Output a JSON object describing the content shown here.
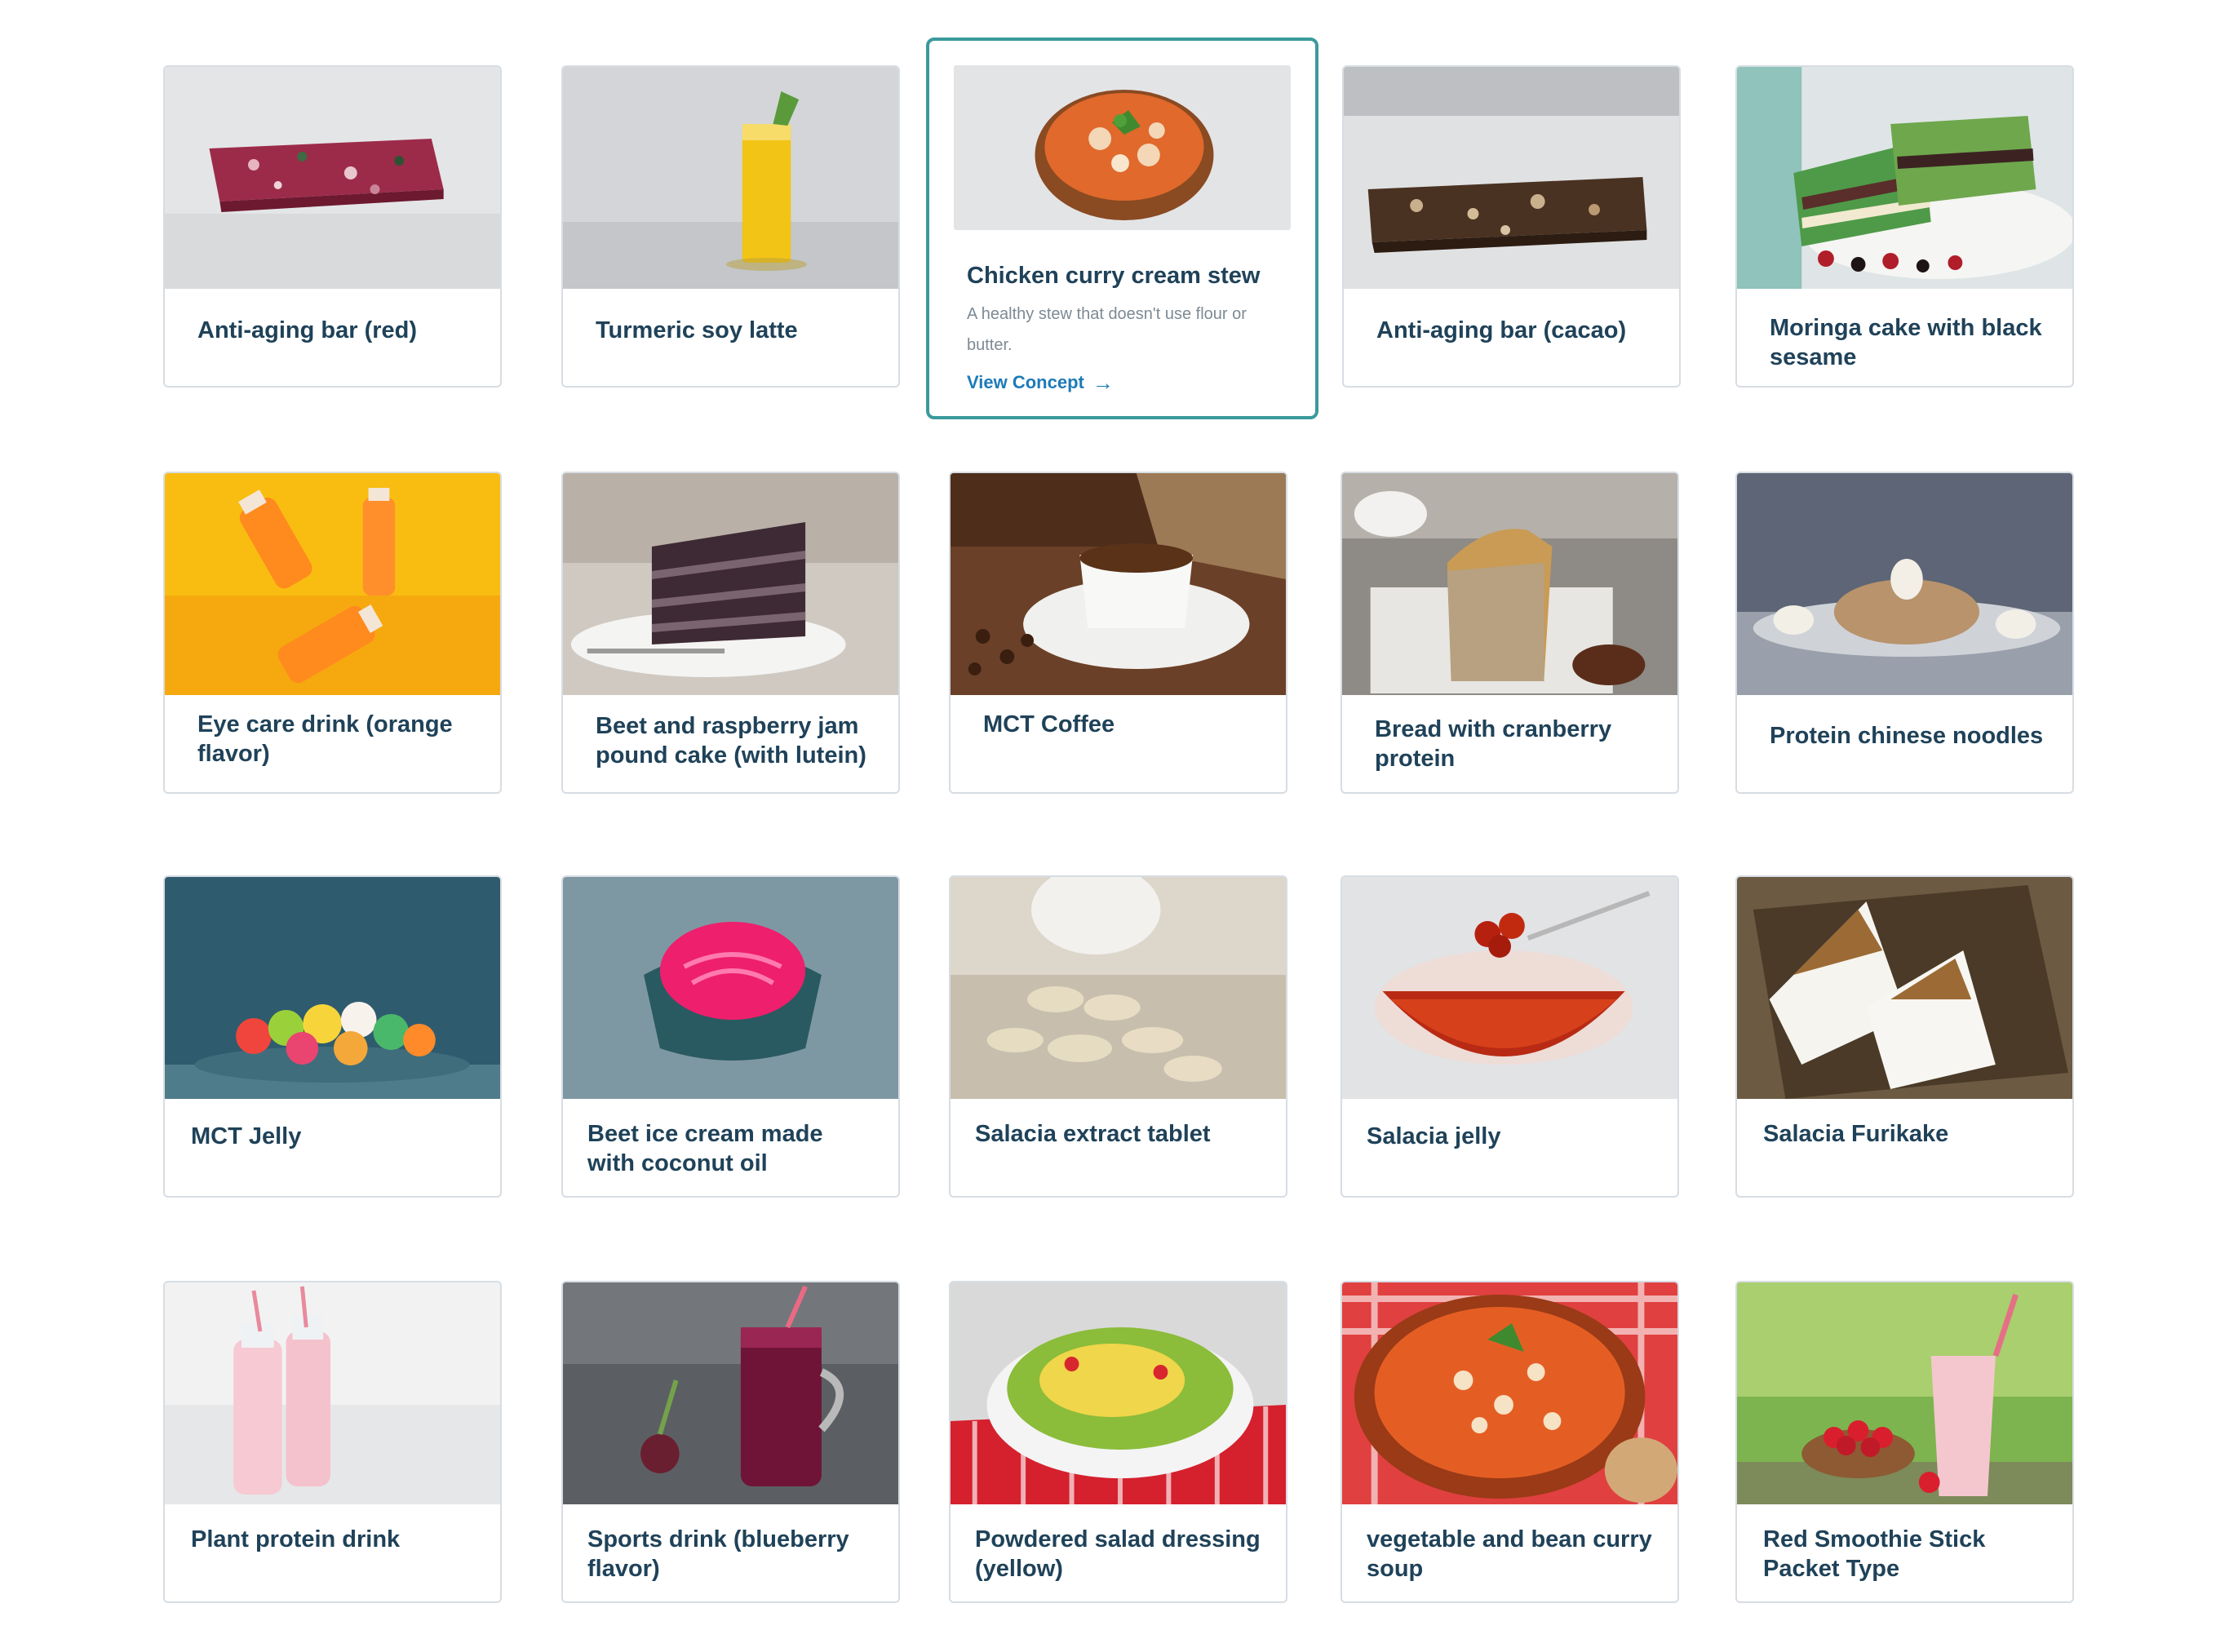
{
  "products": [
    {
      "id": "anti-aging-bar-red",
      "title": "Anti-aging bar (red)",
      "icon": "red-bar-image"
    },
    {
      "id": "turmeric-soy-latte",
      "title": "Turmeric soy latte",
      "icon": "yellow-latte-glass-image"
    },
    {
      "id": "chicken-curry-cream-stew",
      "title": "Chicken curry cream stew",
      "icon": "stew-bowl-image",
      "description": "A healthy stew that doesn't use flour or butter.",
      "link_label": "View Concept"
    },
    {
      "id": "anti-aging-bar-cacao",
      "title": "Anti-aging bar (cacao)",
      "icon": "cacao-bar-image"
    },
    {
      "id": "moringa-cake",
      "title": "Moringa cake with black sesame",
      "icon": "green-layer-cake-image"
    },
    {
      "id": "eye-care-drink",
      "title": "Eye care drink (orange flavor)",
      "icon": "orange-bottles-image"
    },
    {
      "id": "beet-raspberry-cake",
      "title": "Beet and raspberry jam pound cake (with lutein)",
      "icon": "chocolate-cake-slice-image"
    },
    {
      "id": "mct-coffee",
      "title": "MCT Coffee",
      "icon": "coffee-cup-image"
    },
    {
      "id": "bread-cranberry",
      "title": "Bread with cranberry protein",
      "icon": "pound-bread-image"
    },
    {
      "id": "protein-noodles",
      "title": "Protein chinese noodles",
      "icon": "noodle-plate-image"
    },
    {
      "id": "mct-jelly",
      "title": "MCT Jelly",
      "icon": "gummy-candies-image"
    },
    {
      "id": "beet-ice-cream",
      "title": "Beet ice cream made with coconut oil",
      "icon": "pink-ice-cream-bowl-image"
    },
    {
      "id": "salacia-tablet",
      "title": "Salacia extract tablet",
      "icon": "tablets-bottle-image"
    },
    {
      "id": "salacia-jelly",
      "title": "Salacia jelly",
      "icon": "jelly-bowl-image"
    },
    {
      "id": "salacia-furikake",
      "title": "Salacia Furikake",
      "icon": "rice-ball-image"
    },
    {
      "id": "plant-protein-drink",
      "title": "Plant protein drink",
      "icon": "pink-milk-bottles-image"
    },
    {
      "id": "sports-drink",
      "title": "Sports drink (blueberry flavor)",
      "icon": "berry-drink-jar-image"
    },
    {
      "id": "salad-dressing",
      "title": "Powdered salad dressing (yellow)",
      "icon": "salad-bowl-image"
    },
    {
      "id": "bean-curry-soup",
      "title": "vegetable and bean curry soup",
      "icon": "bean-soup-pot-image"
    },
    {
      "id": "red-smoothie",
      "title": "Red Smoothie Stick Packet Type",
      "icon": "strawberry-smoothie-image"
    }
  ],
  "colors": {
    "title": "#1f4259",
    "border": "#d7dde3",
    "active_border": "#3a9a9c",
    "link": "#1d7ab8",
    "desc": "#7d8a94"
  }
}
